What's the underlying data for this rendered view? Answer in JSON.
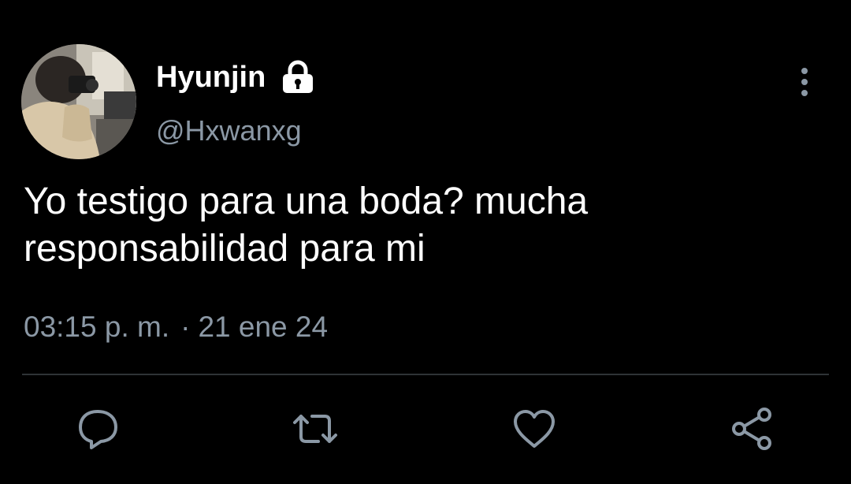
{
  "tweet": {
    "author": {
      "display_name": "Hyunjin",
      "handle": "@Hxwanxg",
      "protected_icon": "lock-icon",
      "avatar": "profile-photo"
    },
    "text": "Yo testigo para una boda? mucha responsabilidad para mi",
    "time": "03:15 p. m.",
    "separator": "·",
    "date": "21 ene 24",
    "menu_icon": "more-vertical-icon"
  },
  "actions": {
    "reply": "reply-icon",
    "retweet": "retweet-icon",
    "like": "like-icon",
    "share": "share-icon"
  },
  "colors": {
    "background": "#000000",
    "primary_text": "#ffffff",
    "secondary_text": "#8b98a5",
    "divider": "#2f3336"
  }
}
